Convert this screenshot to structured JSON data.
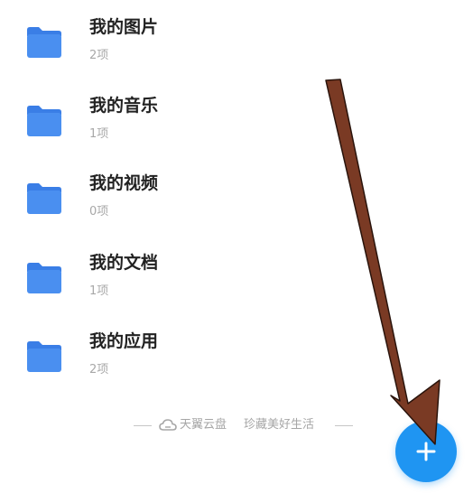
{
  "folders": [
    {
      "name": "我的图片",
      "count": "2项",
      "icon": "folder-icon"
    },
    {
      "name": "我的音乐",
      "count": "1项",
      "icon": "folder-icon"
    },
    {
      "name": "我的视频",
      "count": "0项",
      "icon": "folder-icon"
    },
    {
      "name": "我的文档",
      "count": "1项",
      "icon": "folder-icon"
    },
    {
      "name": "我的应用",
      "count": "2项",
      "icon": "folder-icon"
    }
  ],
  "footer": {
    "brand": "天翼云盘",
    "slogan": "珍藏美好生活",
    "icon": "cloud-icon"
  },
  "fab": {
    "icon": "plus-icon"
  },
  "annotation": {
    "icon": "arrow-pointer",
    "color": "#7a3a24"
  },
  "colors": {
    "folder": "#4a8ff0",
    "folder_tab": "#3a7ee6",
    "fab": "#1f95f2",
    "name_text": "#222222",
    "count_text": "#a8a8a8"
  }
}
